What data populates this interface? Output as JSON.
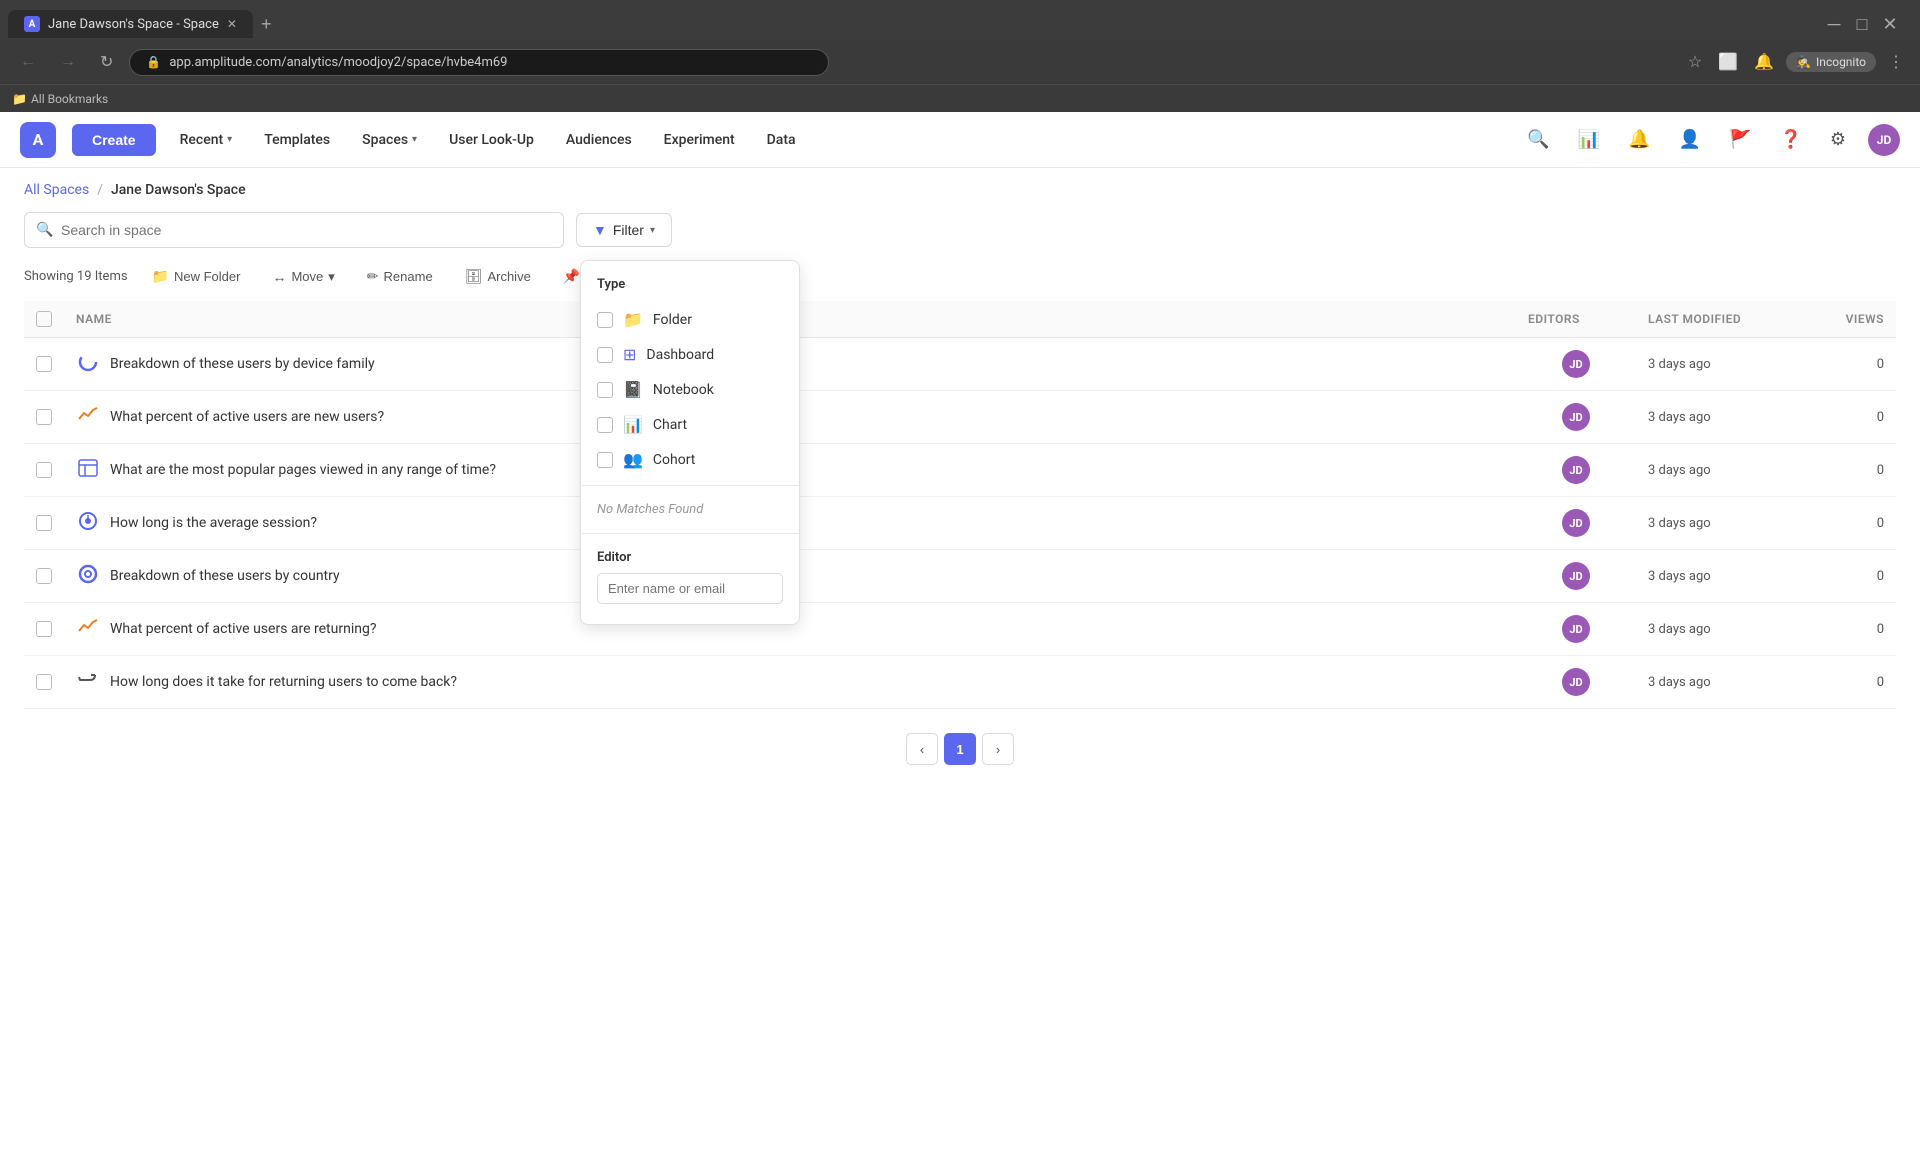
{
  "browser": {
    "tab_title": "Jane Dawson's Space - Space",
    "url": "app.amplitude.com/analytics/moodjoy2/space/hvbe4m69",
    "incognito_label": "Incognito",
    "bookmarks_label": "All Bookmarks"
  },
  "nav": {
    "logo_text": "A",
    "create_label": "Create",
    "items": [
      {
        "id": "recent",
        "label": "Recent",
        "has_caret": true
      },
      {
        "id": "templates",
        "label": "Templates",
        "has_caret": false
      },
      {
        "id": "spaces",
        "label": "Spaces",
        "has_caret": true
      },
      {
        "id": "user-lookup",
        "label": "User Look-Up",
        "has_caret": false
      },
      {
        "id": "audiences",
        "label": "Audiences",
        "has_caret": false
      },
      {
        "id": "experiment",
        "label": "Experiment",
        "has_caret": false
      },
      {
        "id": "data",
        "label": "Data",
        "has_caret": false
      }
    ],
    "user_initials": "JD"
  },
  "breadcrumb": {
    "parent_label": "All Spaces",
    "parent_url": "#",
    "separator": "/",
    "current_label": "Jane Dawson's Space"
  },
  "toolbar": {
    "search_placeholder": "Search in space",
    "filter_label": "Filter",
    "items_count": "Showing 19 Items",
    "new_folder_label": "New Folder",
    "move_label": "Move",
    "rename_label": "Rename",
    "archive_label": "Archive",
    "pin_label": "Pi..."
  },
  "table": {
    "columns": [
      "NAME",
      "EDITORS",
      "LAST MODIFIED",
      "VIEWS"
    ],
    "rows": [
      {
        "id": 1,
        "icon_type": "loading-circle",
        "name": "Breakdown of these users by device family",
        "editor_initials": "JD",
        "modified": "3 days ago",
        "views": "0"
      },
      {
        "id": 2,
        "icon_type": "trend",
        "name": "What percent of active users are new users?",
        "editor_initials": "JD",
        "modified": "3 days ago",
        "views": "0"
      },
      {
        "id": 3,
        "icon_type": "table",
        "name": "What are the most popular pages viewed in any range of time?",
        "editor_initials": "JD",
        "modified": "3 days ago",
        "views": "0"
      },
      {
        "id": 4,
        "icon_type": "timer-circle",
        "name": "How long is the average session?",
        "editor_initials": "JD",
        "modified": "3 days ago",
        "views": "0"
      },
      {
        "id": 5,
        "icon_type": "loading-circle-outline",
        "name": "Breakdown of these users by country",
        "editor_initials": "JD",
        "modified": "3 days ago",
        "views": "0"
      },
      {
        "id": 6,
        "icon_type": "trend",
        "name": "What percent of active users are returning?",
        "editor_initials": "JD",
        "modified": "3 days ago",
        "views": "0"
      },
      {
        "id": 7,
        "icon_type": "return-arrow",
        "name": "How long does it take for returning users to come back?",
        "editor_initials": "JD",
        "modified": "3 days ago",
        "views": "0"
      }
    ]
  },
  "filter_dropdown": {
    "type_section_label": "Type",
    "options": [
      {
        "id": "folder",
        "label": "Folder",
        "icon": "📁"
      },
      {
        "id": "dashboard",
        "label": "Dashboard",
        "icon": "⊞"
      },
      {
        "id": "notebook",
        "label": "Notebook",
        "icon": "📓"
      },
      {
        "id": "chart",
        "label": "Chart",
        "icon": "📊"
      },
      {
        "id": "cohort",
        "label": "Cohort",
        "icon": "👥"
      }
    ],
    "no_matches_text": "No Matches Found",
    "editor_section_label": "Editor",
    "editor_placeholder": "Enter name or email"
  },
  "pagination": {
    "prev_label": "‹",
    "current_page": "1",
    "next_label": "›"
  }
}
